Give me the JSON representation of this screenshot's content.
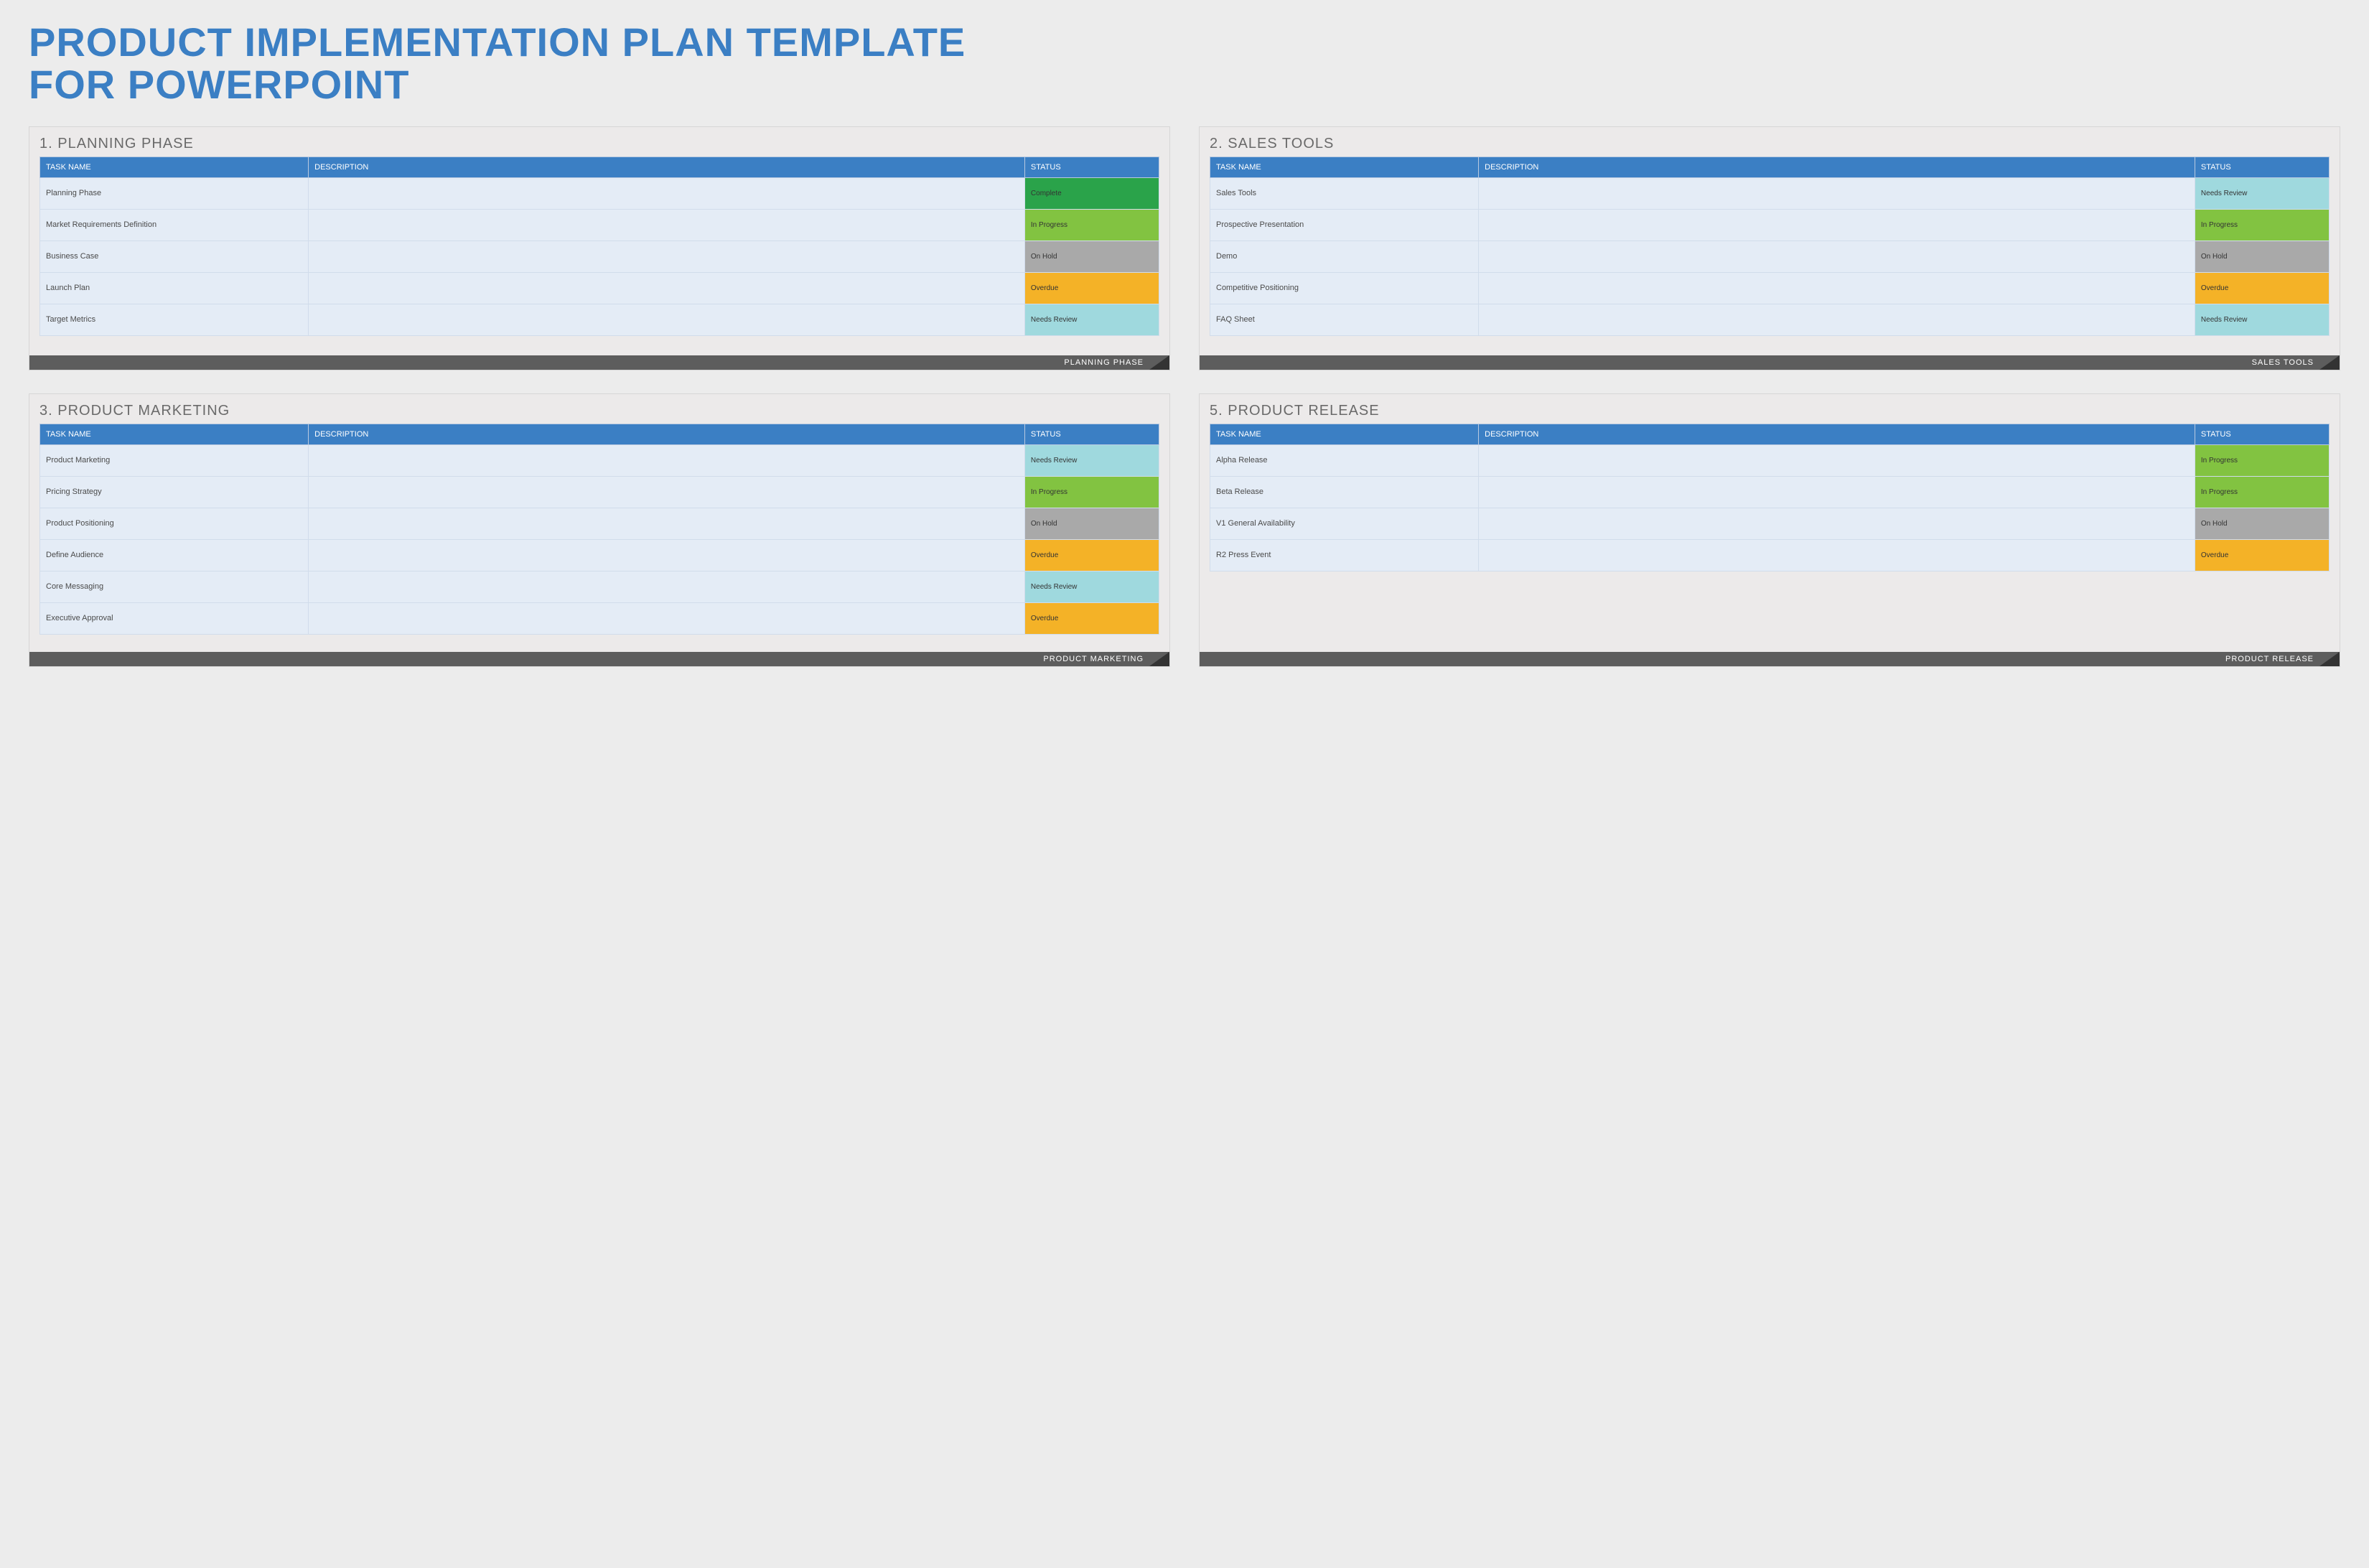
{
  "title_line1": "PRODUCT IMPLEMENTATION PLAN TEMPLATE",
  "title_line2": "FOR POWERPOINT",
  "columns": {
    "task": "TASK NAME",
    "desc": "DESCRIPTION",
    "status": "STATUS"
  },
  "status_colors": {
    "Complete": "#2aa34a",
    "In Progress": "#82c341",
    "On Hold": "#a9a9a9",
    "Overdue": "#f4b227",
    "Needs Review": "#9fd9de"
  },
  "cards": [
    {
      "title": "1. PLANNING PHASE",
      "footer": "PLANNING PHASE",
      "rows": [
        {
          "task": "Planning Phase",
          "desc": "",
          "status": "Complete"
        },
        {
          "task": "Market Requirements Definition",
          "desc": "",
          "status": "In Progress"
        },
        {
          "task": "Business Case",
          "desc": "",
          "status": "On Hold"
        },
        {
          "task": "Launch Plan",
          "desc": "",
          "status": "Overdue"
        },
        {
          "task": "Target Metrics",
          "desc": "",
          "status": "Needs Review"
        }
      ]
    },
    {
      "title": "2. SALES TOOLS",
      "footer": "SALES TOOLS",
      "rows": [
        {
          "task": "Sales Tools",
          "desc": "",
          "status": "Needs Review"
        },
        {
          "task": "Prospective Presentation",
          "desc": "",
          "status": "In Progress"
        },
        {
          "task": "Demo",
          "desc": "",
          "status": "On Hold"
        },
        {
          "task": "Competitive Positioning",
          "desc": "",
          "status": "Overdue"
        },
        {
          "task": "FAQ Sheet",
          "desc": "",
          "status": "Needs Review"
        }
      ]
    },
    {
      "title": "3. PRODUCT MARKETING",
      "footer": "PRODUCT MARKETING",
      "rows": [
        {
          "task": "Product Marketing",
          "desc": "",
          "status": "Needs Review"
        },
        {
          "task": "Pricing Strategy",
          "desc": "",
          "status": "In Progress"
        },
        {
          "task": "Product Positioning",
          "desc": "",
          "status": "On Hold"
        },
        {
          "task": "Define Audience",
          "desc": "",
          "status": "Overdue"
        },
        {
          "task": "Core Messaging",
          "desc": "",
          "status": "Needs Review"
        },
        {
          "task": "Executive Approval",
          "desc": "",
          "status": "Overdue"
        }
      ]
    },
    {
      "title": "5. PRODUCT RELEASE",
      "footer": "PRODUCT RELEASE",
      "rows": [
        {
          "task": "Alpha Release",
          "desc": "",
          "status": "In Progress"
        },
        {
          "task": "Beta Release",
          "desc": "",
          "status": "In Progress"
        },
        {
          "task": "V1 General Availability",
          "desc": "",
          "status": "On Hold"
        },
        {
          "task": "R2 Press Event",
          "desc": "",
          "status": "Overdue"
        }
      ]
    }
  ]
}
